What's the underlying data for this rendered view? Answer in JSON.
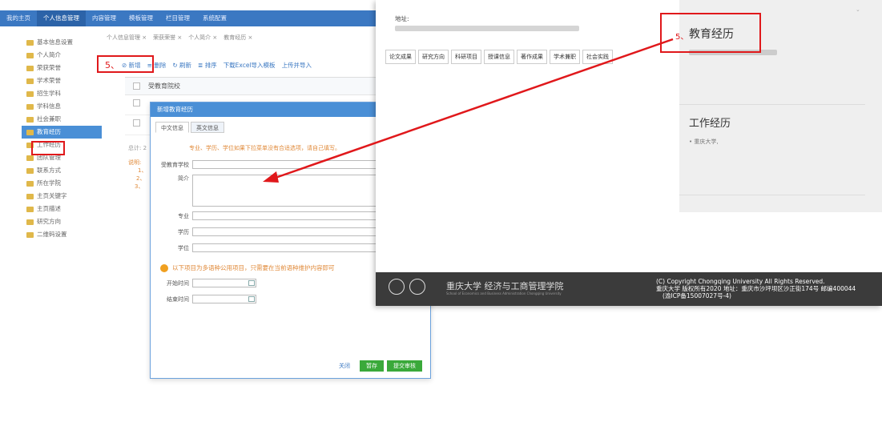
{
  "topnav": [
    "我的主页",
    "个人信息管理",
    "内容管理",
    "模板管理",
    "栏目管理",
    "系统配置"
  ],
  "sidebar": [
    "基本信息设置",
    "个人简介",
    "荣获荣誉",
    "学术荣誉",
    "招生学科",
    "学科信息",
    "社会兼职",
    "教育经历",
    "工作经历",
    "团队管理",
    "联系方式",
    "所在学院",
    "主页关键字",
    "主页描述",
    "研究方向",
    "二维码设置"
  ],
  "breadcrumbs": [
    "个人信息管理 ×",
    "荣获荣誉 ×",
    "个人简介 ×",
    "教育经历 ×"
  ],
  "toolbar": [
    "新增",
    "删除",
    "刷新",
    "排序",
    "下载Excel导入模板",
    "上传并导入"
  ],
  "table": {
    "header": "受教育院校"
  },
  "total": "总计: 2",
  "note": {
    "title": "说明:",
    "lines": [
      "1、",
      "2、",
      "3、"
    ]
  },
  "dialog": {
    "title": "新增教育经历",
    "tabs": [
      "中文信息",
      "英文信息"
    ],
    "hint": "专业、学历、学位如果下拉菜单没有合适选项，请自己填写。",
    "fields": {
      "school": "受教育学校",
      "intro": "简介",
      "major": "专业",
      "education": "学历",
      "degree": "学位"
    },
    "warn": "以下项目为多语种公用项目，只需要在当前语种维护内容即可",
    "start": "开始时间",
    "end": "结束时间",
    "buttons": {
      "close": "关闭",
      "save": "暂存",
      "submit": "提交审核"
    }
  },
  "right": {
    "address_label": "地址:",
    "tabs": [
      "论文成果",
      "研究方向",
      "科研项目",
      "授课信息",
      "著作成果",
      "学术兼职",
      "社会实践"
    ],
    "edu_title": "教育经历",
    "work_title": "工作经历",
    "work_item": "• 重庆大学,",
    "school_name": "重庆大学 经济与工商管理学院",
    "school_en": "School of Economics and Business Administration Chongqing University",
    "copyright": [
      "(C) Copyright Chongqing University All Rights Reserved.",
      "重庆大学 版权所有2020 地址：重庆市沙坪坝区沙正街174号 邮编400044",
      "(渝ICP备15007027号-4)"
    ]
  },
  "annotations": {
    "step_left": "5、",
    "step_right": "5、"
  },
  "colors": {
    "nav": "#3b78c2",
    "highlight": "#e0181b",
    "arrow": "#e0181b"
  }
}
